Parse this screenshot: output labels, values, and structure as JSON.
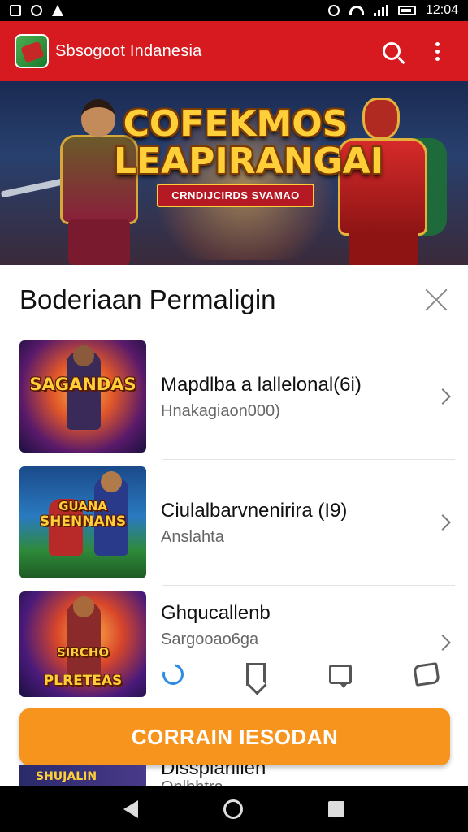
{
  "status_bar": {
    "time": "12:04",
    "left_icons": [
      "image-icon",
      "sync-icon",
      "warning-icon"
    ],
    "right_icons": [
      "alarm-icon",
      "wifi-icon",
      "signal-icon",
      "battery-icon"
    ]
  },
  "app_bar": {
    "title": "Sbsogoot Indanesia",
    "actions": [
      "search-icon",
      "more-vert-icon"
    ],
    "color": "#d71920"
  },
  "banner": {
    "title_line1": "COFEKMOS",
    "title_line2": "LEAPIRANGAI",
    "ribbon": "CRNDIJCIRDS SVAMAO"
  },
  "sheet": {
    "title": "Boderiaan Permaligin",
    "items": [
      {
        "title": "Mapdlba a lallelonal(6i)",
        "subtitle": "Hnakagiaon000)",
        "thumb_label": "SAGANDAS"
      },
      {
        "title": "Ciulalbarvnenirira (I9)",
        "subtitle": "Anslahta",
        "thumb_label_1": "GUANA",
        "thumb_label_2": "SHENNANS"
      },
      {
        "title": "Ghqucallenb",
        "subtitle": "Sargooao6ga",
        "thumb_label_1": "SIRCHO",
        "thumb_label_2": "PLRETEAS"
      },
      {
        "title": "Disspiarilien",
        "subtitle": "Onlbhtra",
        "thumb_label": "SHUJALIN"
      }
    ],
    "mini_actions": [
      "refresh-icon",
      "bookmark-icon",
      "chat-icon",
      "share-icon"
    ],
    "cta_label": "CORRAIN IESODAN",
    "cta_color": "#f7941d"
  },
  "nav_bar": [
    "back-icon",
    "home-icon",
    "recents-icon"
  ]
}
